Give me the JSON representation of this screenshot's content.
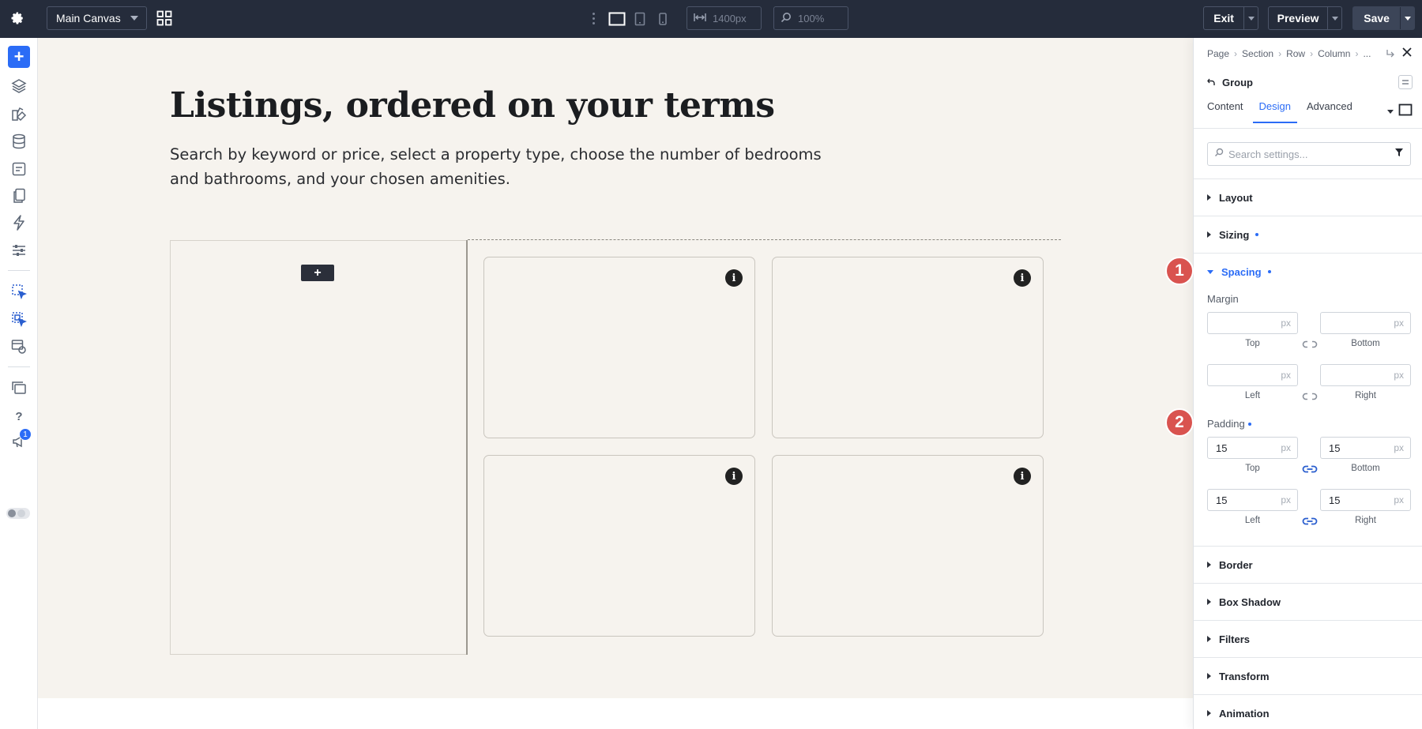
{
  "topbar": {
    "canvas_select": "Main Canvas",
    "width_value": "1400px",
    "zoom_value": "100%",
    "exit_label": "Exit",
    "preview_label": "Preview",
    "save_label": "Save"
  },
  "rail": {
    "notification_count": "1"
  },
  "canvas": {
    "heading": "Listings, ordered on your terms",
    "subtext": "Search by keyword or price, select a property type, choose the number of bedrooms and bathrooms, and your chosen amenities."
  },
  "panel": {
    "breadcrumbs": [
      "Page",
      "Section",
      "Row",
      "Column",
      "..."
    ],
    "group_label": "Group",
    "tabs": [
      "Content",
      "Design",
      "Advanced"
    ],
    "search_placeholder": "Search settings...",
    "sections": {
      "layout": "Layout",
      "sizing": "Sizing",
      "spacing": "Spacing",
      "border": "Border",
      "box_shadow": "Box Shadow",
      "filters": "Filters",
      "transform": "Transform",
      "animation": "Animation"
    },
    "margin": {
      "label": "Margin",
      "top": "",
      "bottom": "",
      "left": "",
      "right": "",
      "unit": "px",
      "cap_top": "Top",
      "cap_bottom": "Bottom",
      "cap_left": "Left",
      "cap_right": "Right"
    },
    "padding": {
      "label": "Padding",
      "top": "15",
      "bottom": "15",
      "left": "15",
      "right": "15",
      "unit": "px",
      "cap_top": "Top",
      "cap_bottom": "Bottom",
      "cap_left": "Left",
      "cap_right": "Right"
    }
  },
  "steps": [
    "1",
    "2"
  ],
  "colors": {
    "topbar": "#252c3b",
    "accent": "#2b6cf6",
    "canvas": "#f6f3ee",
    "step_badge": "#d9534f"
  }
}
